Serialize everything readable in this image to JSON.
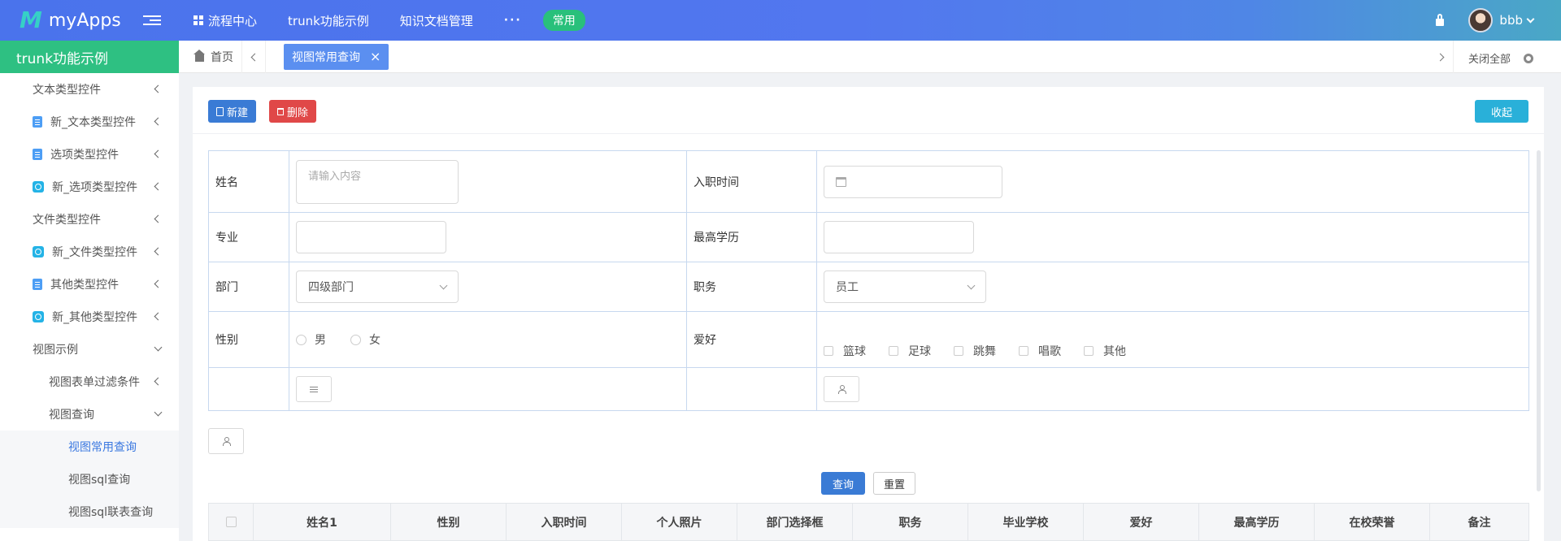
{
  "app": {
    "name": "myApps"
  },
  "topnav": {
    "items": [
      "流程中心",
      "trunk功能示例",
      "知识文档管理"
    ],
    "more": "···",
    "pill": "常用",
    "username": "bbb"
  },
  "sidebar": {
    "title": "trunk功能示例",
    "items": [
      {
        "label": "文本类型控件",
        "icon": "none"
      },
      {
        "label": "新_文本类型控件",
        "icon": "doc-icon"
      },
      {
        "label": "选项类型控件",
        "icon": "doc-icon"
      },
      {
        "label": "新_选项类型控件",
        "icon": "box-icon"
      },
      {
        "label": "文件类型控件",
        "icon": "none"
      },
      {
        "label": "新_文件类型控件",
        "icon": "box-icon"
      },
      {
        "label": "其他类型控件",
        "icon": "doc-icon"
      },
      {
        "label": "新_其他类型控件",
        "icon": "box-icon"
      },
      {
        "label": "视图示例",
        "icon": "none"
      },
      {
        "label": "视图表单过滤条件",
        "icon": "none"
      },
      {
        "label": "视图查询",
        "icon": "none"
      },
      {
        "label": "视图常用查询",
        "icon": "none"
      },
      {
        "label": "视图sql查询",
        "icon": "none"
      },
      {
        "label": "视图sql联表查询",
        "icon": "none"
      }
    ]
  },
  "tabs": {
    "home": "首页",
    "active": "视图常用查询",
    "close_all": "关闭全部"
  },
  "toolbar": {
    "new_label": "新建",
    "delete_label": "删除",
    "fold_label": "收起"
  },
  "form": {
    "name_label": "姓名",
    "name_placeholder": "请输入内容",
    "hire_label": "入职时间",
    "major_label": "专业",
    "edu_label": "最高学历",
    "dept_label": "部门",
    "dept_value": "四级部门",
    "job_label": "职务",
    "job_value": "员工",
    "gender_label": "性别",
    "gender_options": [
      "男",
      "女"
    ],
    "hobby_label": "爱好",
    "hobby_options": [
      "篮球",
      "足球",
      "跳舞",
      "唱歌",
      "其他"
    ]
  },
  "actions": {
    "query": "查询",
    "reset": "重置"
  },
  "table": {
    "columns": [
      "姓名1",
      "性别",
      "入职时间",
      "个人照片",
      "部门选择框",
      "职务",
      "毕业学校",
      "爱好",
      "最高学历",
      "在校荣誉",
      "备注"
    ]
  },
  "colors": {
    "accent": "#3a7bd5",
    "sidebar_title": "#2ec082",
    "danger": "#e04848"
  }
}
